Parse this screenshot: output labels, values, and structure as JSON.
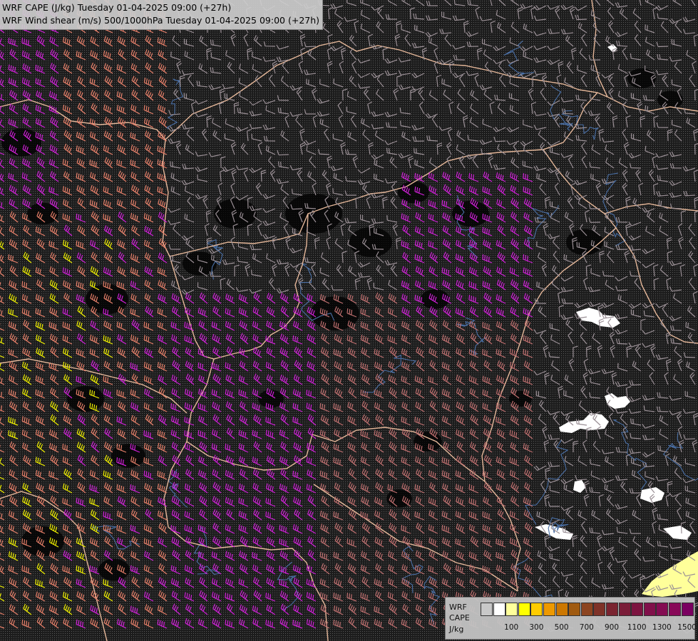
{
  "title": {
    "line1": "WRF CAPE (J/kg) Tuesday 01-04-2025 09:00 (+27h)",
    "line2": "WRF Wind shear (m/s) 500/1000hPa Tuesday 01-04-2025 09:00 (+27h)"
  },
  "legend": {
    "label_lines": [
      "WRF",
      "CAPE",
      "J/kg"
    ],
    "swatch_colors": [
      "#c8c8c8",
      "#ffffff",
      "#ffff9a",
      "#ffff00",
      "#ffcc00",
      "#ee9900",
      "#cc7700",
      "#a05a10",
      "#8c4420",
      "#7e3228",
      "#7a2430",
      "#7a1c38",
      "#7c1440",
      "#80104a",
      "#840c52",
      "#880858",
      "#7a0060"
    ],
    "tick_labels": [
      "100",
      "300",
      "500",
      "700",
      "900",
      "1100",
      "1300",
      "1500"
    ]
  },
  "colors": {
    "background": "#1c1c1c",
    "borders": "#e6b89a",
    "rivers": "#4a6fa5",
    "barb_default": "#9a8f95",
    "barb_salmon": "#e8806a",
    "barb_magenta": "#d020d8",
    "barb_yellow": "#f0f000",
    "barb_mauve": "#c07070",
    "cape_low": "#ffffff",
    "cape_mid": "#ffff9a"
  },
  "icons": {
    "barb": "wind-barb-icon"
  }
}
